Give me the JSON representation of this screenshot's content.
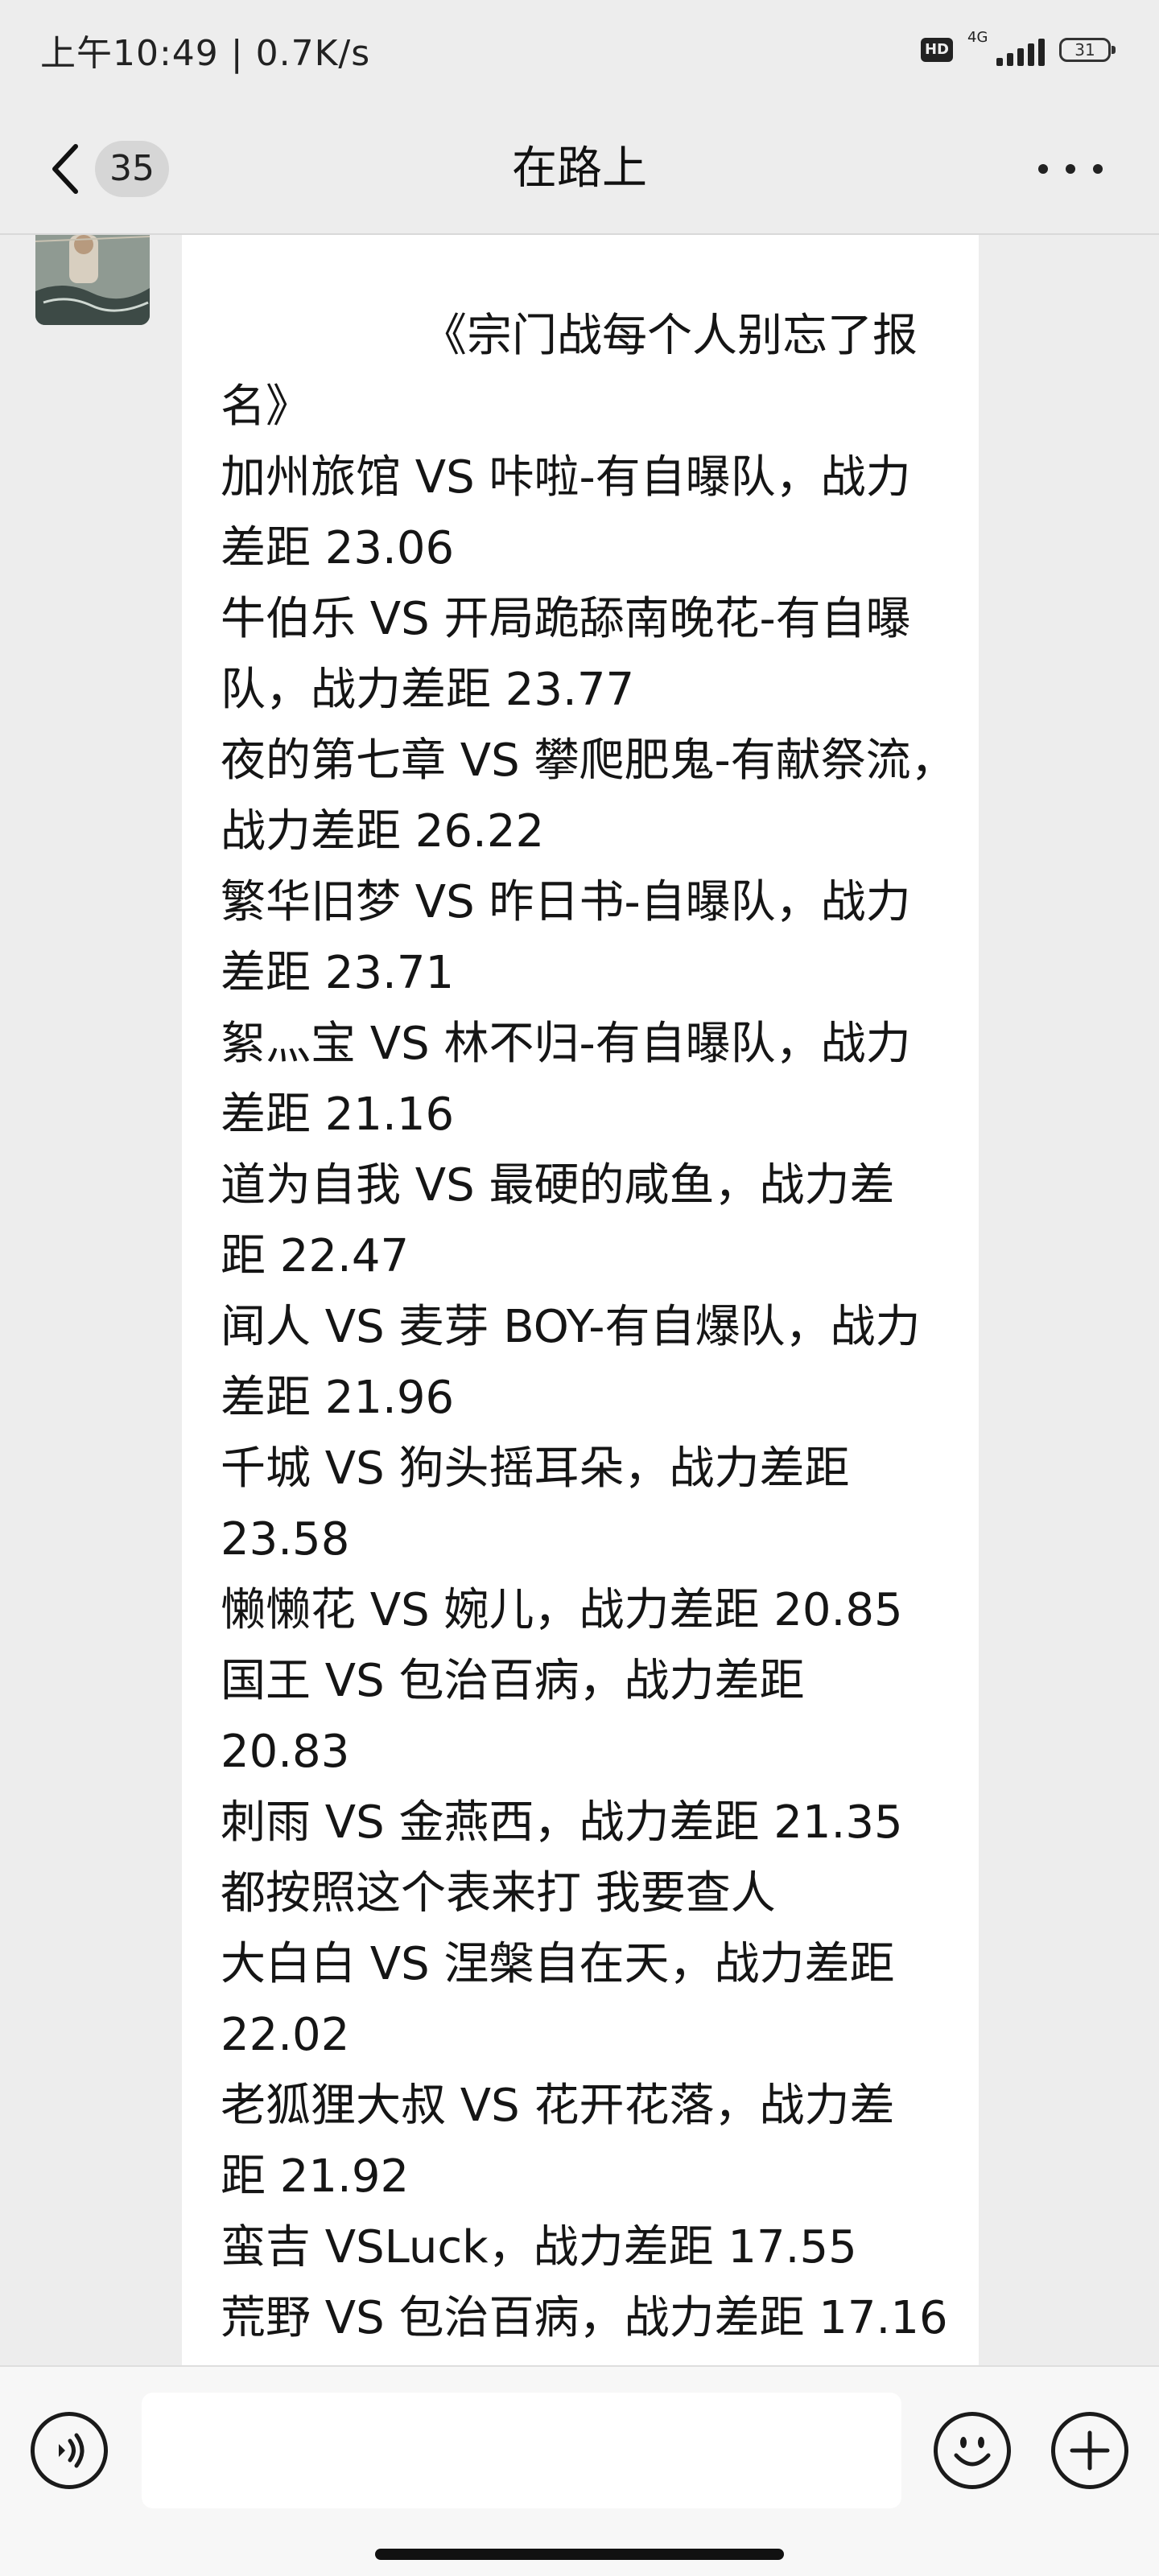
{
  "status_bar": {
    "time_speed": "上午10:49 | 0.7K/s",
    "hd_label": "HD",
    "network_label": "4G",
    "battery_level": "31",
    "icons": [
      "hd-icon",
      "signal-icon",
      "battery-icon"
    ]
  },
  "header": {
    "unread_count": "35",
    "title": "在路上",
    "icons": [
      "chevron-left-icon",
      "more-icon"
    ]
  },
  "message": {
    "lines": [
      "《宗门战每个人别忘了报",
      "名》",
      "加州旅馆 VS 咔啦-有自曝队，战力",
      "差距 23.06",
      "牛伯乐 VS 开局跪舔南晚花-有自曝",
      "队，战力差距 23.77",
      "夜的第七章 VS 攀爬肥鬼-有献祭流，",
      "战力差距 26.22",
      "繁华旧梦 VS 昨日书-自曝队，战力",
      "差距 23.71",
      "絮灬宝 VS 林不归-有自曝队，战力",
      "差距 21.16",
      "道为自我 VS 最硬的咸鱼，战力差",
      "距 22.47",
      "闻人 VS 麦芽 BOY-有自爆队，战力",
      "差距 21.96",
      "千城 VS 狗头摇耳朵，战力差距",
      "23.58",
      "懒懒花 VS 婉儿，战力差距 20.85",
      "国王 VS 包治百病，战力差距",
      "20.83",
      "刺雨 VS 金燕西，战力差距 21.35",
      "都按照这个表来打 我要查人",
      "大白白 VS 涅槃自在天，战力差距",
      "22.02",
      "老狐狸大叔 VS 花开花落，战力差",
      "距 21.92",
      "蛮吉 VSLuck，战力差距 17.55",
      "荒野 VS 包治百病，战力差距 17.16"
    ]
  },
  "input_bar": {
    "placeholder": "",
    "icons": [
      "voice-icon",
      "emoji-icon",
      "plus-icon"
    ]
  },
  "colors": {
    "background": "#ededed",
    "bubble": "#ffffff",
    "input_bar": "#f7f7f7",
    "text": "#151515"
  }
}
